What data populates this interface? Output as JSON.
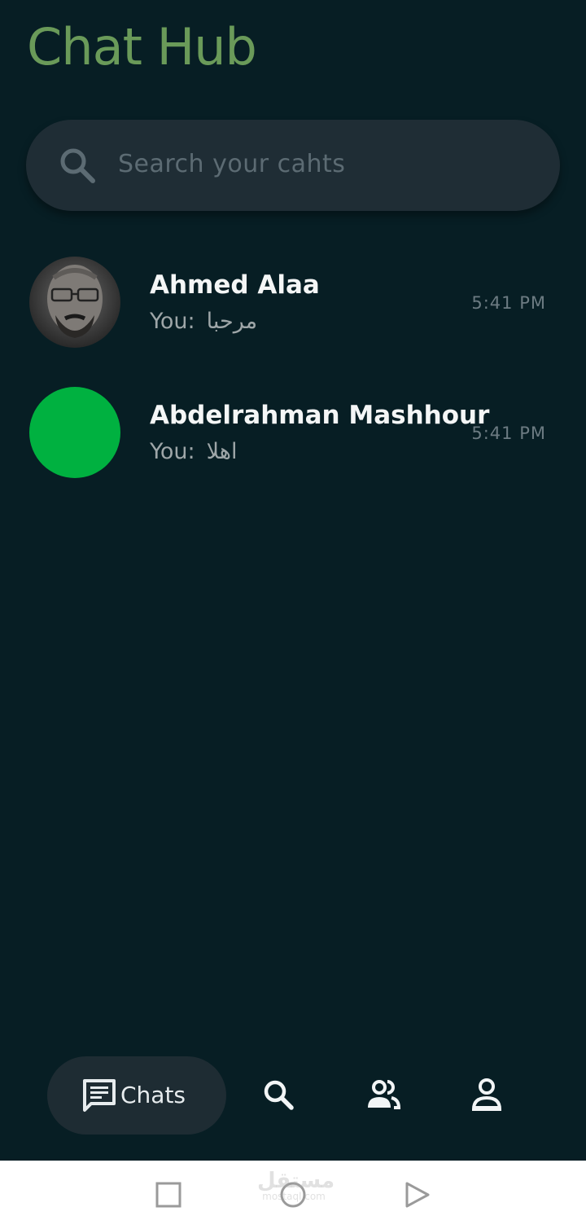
{
  "app": {
    "title": "Chat Hub",
    "accent_color": "#6a9a59",
    "background_color": "#071e24"
  },
  "search": {
    "placeholder": "Search your cahts",
    "icon": "search-icon"
  },
  "chats": [
    {
      "name": "Ahmed Alaa",
      "preview_prefix": "You:",
      "preview_message": "مرحبا",
      "time": "5:41 PM",
      "avatar": "photo"
    },
    {
      "name": "Abdelrahman Mashhour",
      "preview_prefix": "You:",
      "preview_message": "اهلا",
      "time": "5:41 PM",
      "avatar": "green-circle",
      "avatar_color": "#00b140"
    }
  ],
  "bottom_nav": {
    "items": [
      {
        "label": "Chats",
        "icon": "chat-icon",
        "active": true
      },
      {
        "label": "",
        "icon": "search-icon",
        "active": false
      },
      {
        "label": "",
        "icon": "group-icon",
        "active": false
      },
      {
        "label": "",
        "icon": "person-icon",
        "active": false
      }
    ]
  },
  "system_nav": {
    "buttons": [
      "square-recents-icon",
      "circle-home-icon",
      "triangle-back-icon"
    ],
    "watermark": "مستقل",
    "watermark_sub": "mostaql.com"
  }
}
